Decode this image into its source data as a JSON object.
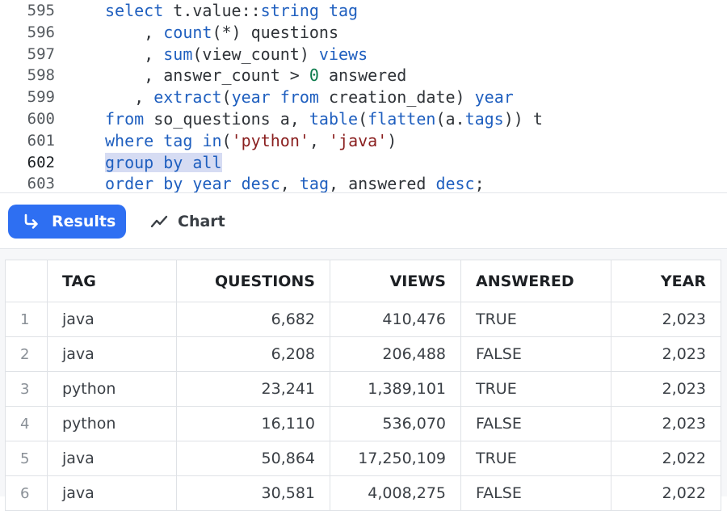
{
  "editor": {
    "lines": [
      {
        "number": "595",
        "current": false,
        "tokens": [
          {
            "t": "select",
            "c": "kw"
          },
          {
            "t": " t.value::",
            "c": "plain"
          },
          {
            "t": "string",
            "c": "kw"
          },
          {
            "t": " ",
            "c": "plain"
          },
          {
            "t": "tag",
            "c": "kw"
          }
        ]
      },
      {
        "number": "596",
        "current": false,
        "tokens": [
          {
            "t": "    , ",
            "c": "plain"
          },
          {
            "t": "count",
            "c": "kw"
          },
          {
            "t": "(*) questions",
            "c": "plain"
          }
        ]
      },
      {
        "number": "597",
        "current": false,
        "tokens": [
          {
            "t": "    , ",
            "c": "plain"
          },
          {
            "t": "sum",
            "c": "kw"
          },
          {
            "t": "(view_count) ",
            "c": "plain"
          },
          {
            "t": "views",
            "c": "kw"
          }
        ]
      },
      {
        "number": "598",
        "current": false,
        "tokens": [
          {
            "t": "    , answer_count > ",
            "c": "plain"
          },
          {
            "t": "0",
            "c": "num"
          },
          {
            "t": " answered",
            "c": "plain"
          }
        ]
      },
      {
        "number": "599",
        "current": false,
        "tokens": [
          {
            "t": "   , ",
            "c": "plain"
          },
          {
            "t": "extract",
            "c": "kw"
          },
          {
            "t": "(",
            "c": "plain"
          },
          {
            "t": "year",
            "c": "kw"
          },
          {
            "t": " ",
            "c": "plain"
          },
          {
            "t": "from",
            "c": "kw"
          },
          {
            "t": " creation_date) ",
            "c": "plain"
          },
          {
            "t": "year",
            "c": "kw"
          }
        ]
      },
      {
        "number": "600",
        "current": false,
        "tokens": [
          {
            "t": "from",
            "c": "kw"
          },
          {
            "t": " so_questions a, ",
            "c": "plain"
          },
          {
            "t": "table",
            "c": "kw"
          },
          {
            "t": "(",
            "c": "plain"
          },
          {
            "t": "flatten",
            "c": "kw"
          },
          {
            "t": "(a.",
            "c": "plain"
          },
          {
            "t": "tags",
            "c": "kw"
          },
          {
            "t": ")) t",
            "c": "plain"
          }
        ]
      },
      {
        "number": "601",
        "current": false,
        "tokens": [
          {
            "t": "where",
            "c": "kw"
          },
          {
            "t": " ",
            "c": "plain"
          },
          {
            "t": "tag",
            "c": "kw"
          },
          {
            "t": " ",
            "c": "plain"
          },
          {
            "t": "in",
            "c": "kw"
          },
          {
            "t": "(",
            "c": "plain"
          },
          {
            "t": "'python'",
            "c": "str"
          },
          {
            "t": ", ",
            "c": "plain"
          },
          {
            "t": "'java'",
            "c": "str"
          },
          {
            "t": ")",
            "c": "plain"
          }
        ]
      },
      {
        "number": "602",
        "current": true,
        "tokens": [
          {
            "t": "group by all",
            "c": "kw sel"
          }
        ]
      },
      {
        "number": "603",
        "current": false,
        "tokens": [
          {
            "t": "order by",
            "c": "kw"
          },
          {
            "t": " ",
            "c": "plain"
          },
          {
            "t": "year",
            "c": "kw"
          },
          {
            "t": " ",
            "c": "plain"
          },
          {
            "t": "desc",
            "c": "kw"
          },
          {
            "t": ", ",
            "c": "plain"
          },
          {
            "t": "tag",
            "c": "kw"
          },
          {
            "t": ", answered ",
            "c": "plain"
          },
          {
            "t": "desc",
            "c": "kw"
          },
          {
            "t": ";",
            "c": "plain"
          }
        ]
      }
    ]
  },
  "toolbar": {
    "results_tab": {
      "label": "Results",
      "icon": "arrow-return-icon",
      "active": true
    },
    "chart_tab": {
      "label": "Chart",
      "icon": "line-chart-icon",
      "active": false
    }
  },
  "table": {
    "columns": [
      "",
      "TAG",
      "QUESTIONS",
      "VIEWS",
      "ANSWERED",
      "YEAR"
    ],
    "rows": [
      {
        "index": "1",
        "tag": "java",
        "questions": "6,682",
        "views": "410,476",
        "answered": "TRUE",
        "year": "2,023"
      },
      {
        "index": "2",
        "tag": "java",
        "questions": "6,208",
        "views": "206,488",
        "answered": "FALSE",
        "year": "2,023"
      },
      {
        "index": "3",
        "tag": "python",
        "questions": "23,241",
        "views": "1,389,101",
        "answered": "TRUE",
        "year": "2,023"
      },
      {
        "index": "4",
        "tag": "python",
        "questions": "16,110",
        "views": "536,070",
        "answered": "FALSE",
        "year": "2,023"
      },
      {
        "index": "5",
        "tag": "java",
        "questions": "50,864",
        "views": "17,250,109",
        "answered": "TRUE",
        "year": "2,022"
      },
      {
        "index": "6",
        "tag": "java",
        "questions": "30,581",
        "views": "4,008,275",
        "answered": "FALSE",
        "year": "2,022"
      }
    ]
  },
  "colors": {
    "accent": "#2e6ff2",
    "keyword": "#1f5fbf",
    "string": "#8a1f1f",
    "number": "#0b7a4b",
    "selection": "#d6dcf3"
  }
}
